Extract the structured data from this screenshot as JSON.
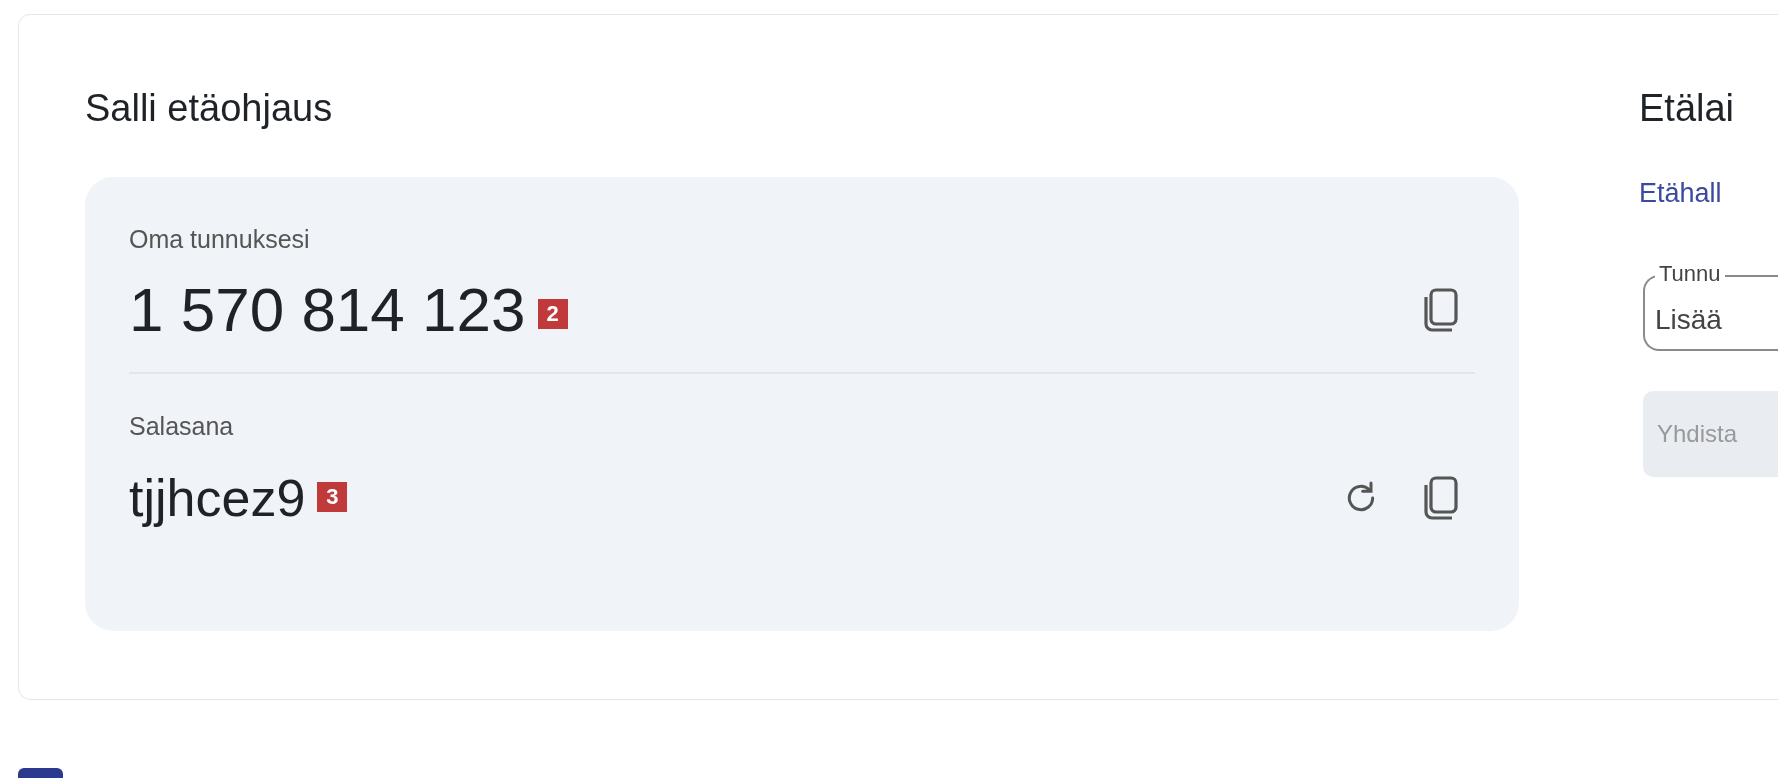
{
  "left_panel": {
    "title": "Salli etäohjaus",
    "fields": [
      {
        "label": "Oma tunnuksesi",
        "value": "1 570 814 123",
        "kind": "id",
        "callout": "2"
      },
      {
        "label": "Salasana",
        "value": "tjjhcez9",
        "kind": "password",
        "callout": "3"
      }
    ]
  },
  "right_panel": {
    "title": "Etälai",
    "link": "Etähall",
    "input": {
      "label": "Tunnu",
      "placeholder": "Lisää"
    },
    "button": {
      "label": "Yhdista",
      "disabled": true
    }
  }
}
